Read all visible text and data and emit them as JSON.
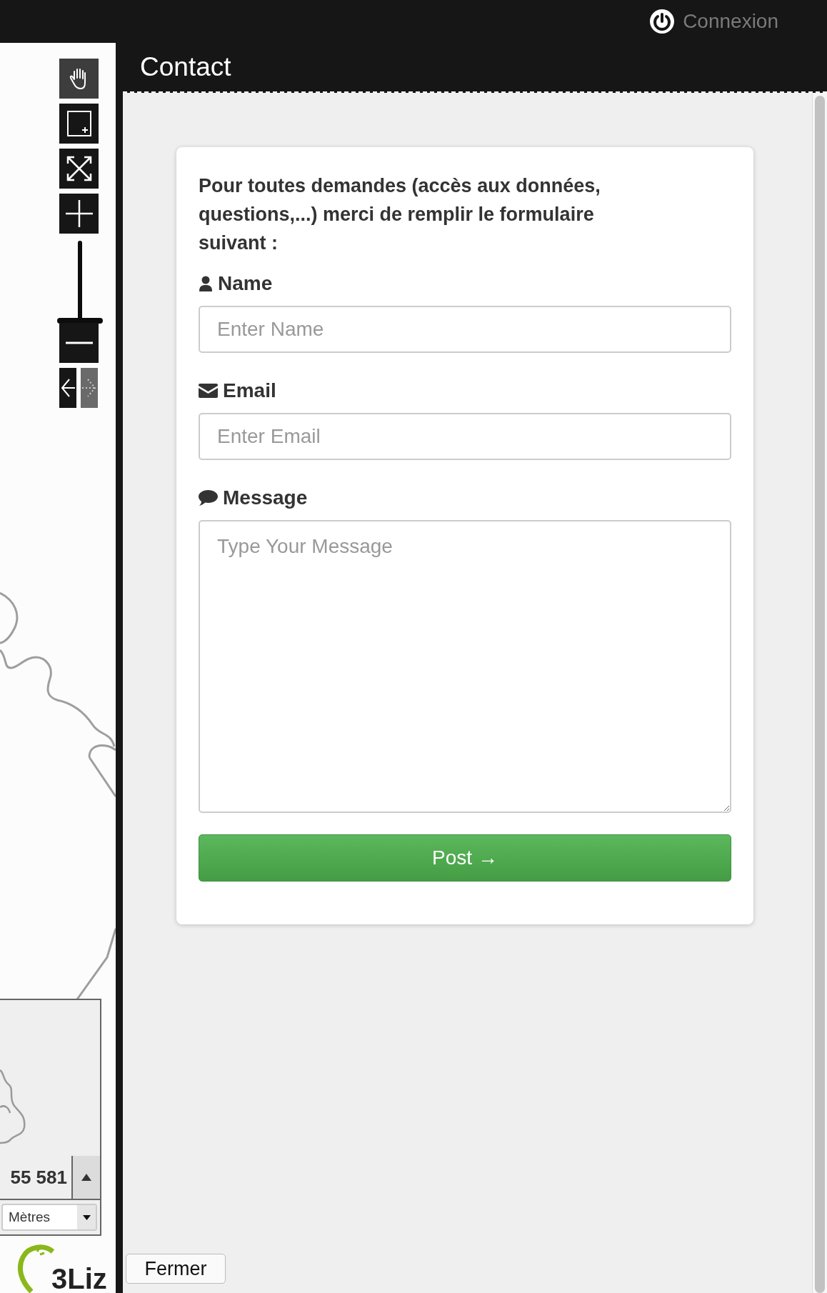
{
  "header": {
    "login": "Connexion"
  },
  "map": {
    "tools": [
      {
        "kind": "pan",
        "selected": true
      },
      {
        "kind": "zoombox",
        "selected": false
      },
      {
        "kind": "extent",
        "selected": false
      }
    ],
    "zoom": {
      "level": 0
    },
    "history": {
      "back_disabled": false,
      "forward_disabled": true
    },
    "scale": {
      "value": "55 581",
      "unit": "Mètres"
    },
    "logo": "3Liz"
  },
  "panel": {
    "title": "Contact",
    "intro": "Pour toutes demandes (accès aux données, questions,...) merci de remplir le formulaire suivant :",
    "fields": [
      {
        "kind": "name",
        "label": "Name",
        "placeholder": "Enter Name"
      },
      {
        "kind": "email",
        "label": "Email",
        "placeholder": "Enter Email"
      },
      {
        "kind": "message",
        "label": "Message",
        "placeholder": "Type Your Message"
      }
    ],
    "submit": "Post →",
    "close": "Fermer"
  }
}
